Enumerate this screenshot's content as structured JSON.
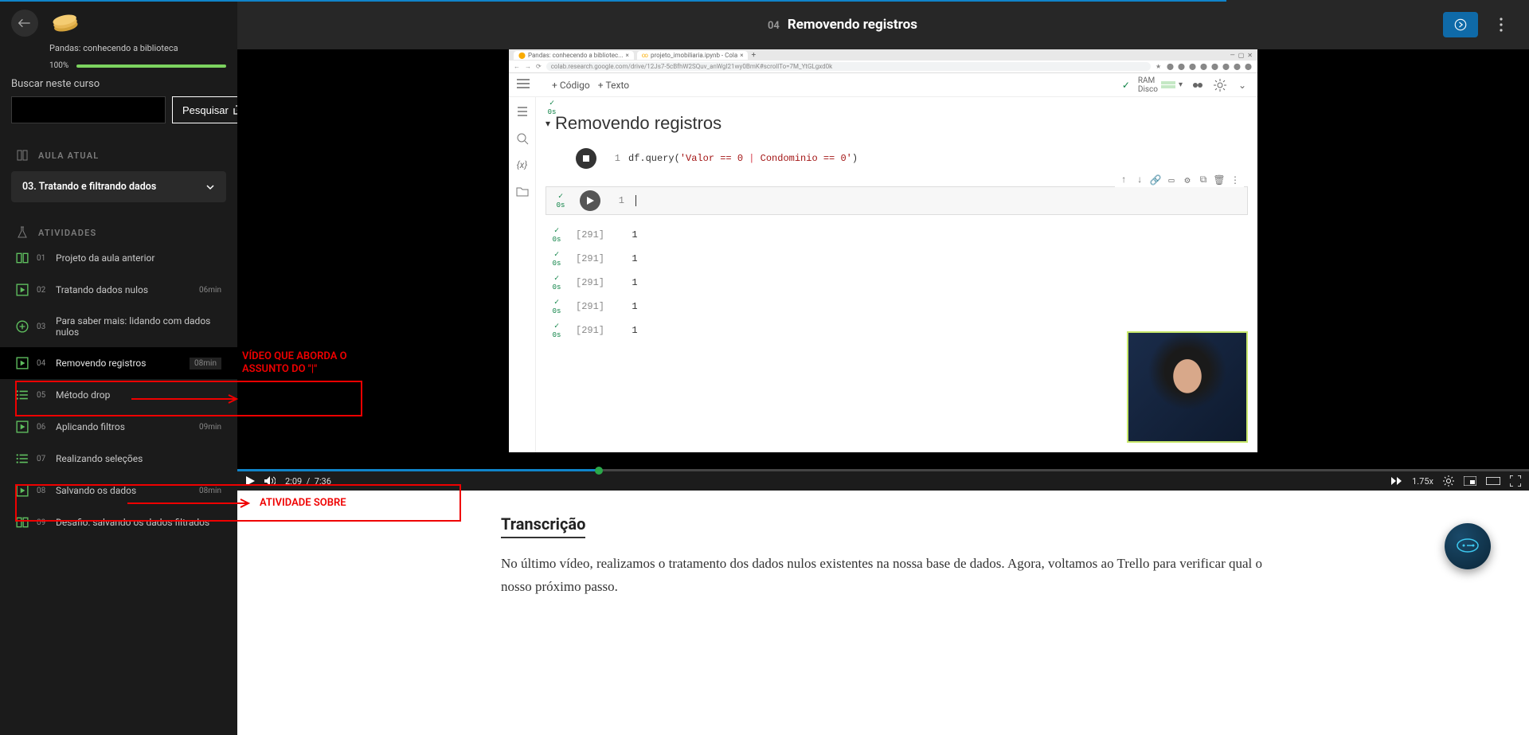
{
  "course": {
    "title": "Pandas: conhecendo a biblioteca",
    "progress_pct": "100%",
    "progress_fill": 100
  },
  "search": {
    "label": "Buscar neste curso",
    "button": "Pesquisar"
  },
  "labels": {
    "current_lesson": "AULA ATUAL",
    "activities": "ATIVIDADES",
    "transcript_title": "Transcrição"
  },
  "lesson": {
    "number": "03.",
    "title": "Tratando e filtrando dados"
  },
  "activities": [
    {
      "num": "01",
      "title": "Projeto da aula anterior",
      "dur": "",
      "icon": "book"
    },
    {
      "num": "02",
      "title": "Tratando dados nulos",
      "dur": "06min",
      "icon": "play"
    },
    {
      "num": "03",
      "title": "Para saber mais: lidando com dados nulos",
      "dur": "",
      "icon": "plus-circle"
    },
    {
      "num": "04",
      "title": "Removendo registros",
      "dur": "08min",
      "icon": "play",
      "active": true
    },
    {
      "num": "05",
      "title": "Método drop",
      "dur": "",
      "icon": "list"
    },
    {
      "num": "06",
      "title": "Aplicando filtros",
      "dur": "09min",
      "icon": "play"
    },
    {
      "num": "07",
      "title": "Realizando seleções",
      "dur": "",
      "icon": "list"
    },
    {
      "num": "08",
      "title": "Salvando os dados",
      "dur": "08min",
      "icon": "play"
    },
    {
      "num": "09",
      "title": "Desafio: salvando os dados filtrados",
      "dur": "",
      "icon": "book"
    }
  ],
  "topbar": {
    "num": "04",
    "title": "Removendo registros"
  },
  "colab": {
    "tabs": [
      "Pandas: conhecendo a bibliotec...",
      "projeto_imobiliaria.ipynb - Cola"
    ],
    "url": "colab.research.google.com/drive/12Js7-5cBfhW2SQuv_anWgI21wy0BmK#scrollTo=7M_YtGLgxd0k",
    "add_code": "Código",
    "add_text": "Texto",
    "ram_label": "RAM",
    "disk_label": "Disco",
    "section_title": "Removendo registros",
    "code_line": "df.query('Valor == 0 | Condominio == 0')",
    "active_line_no": "1",
    "out_cells": [
      {
        "label": "[291]",
        "val": "1"
      },
      {
        "label": "[291]",
        "val": "1"
      },
      {
        "label": "[291]",
        "val": "1"
      },
      {
        "label": "[291]",
        "val": "1"
      },
      {
        "label": "[291]",
        "val": "1"
      }
    ],
    "cell_status_0s": "0s"
  },
  "controls": {
    "cur": "2:09",
    "sep": "/",
    "total": "7:36",
    "speed": "1.75x"
  },
  "transcript": {
    "body": "No último vídeo, realizamos o tratamento dos dados nulos existentes na nossa base de dados. Agora, voltamos ao Trello para verificar qual o nosso próximo passo."
  },
  "annotations": {
    "video_label": "VÍDEO QUE ABORDA O ASSUNTO DO \"|\"",
    "activity_label": "ATIVIDADE SOBRE"
  }
}
